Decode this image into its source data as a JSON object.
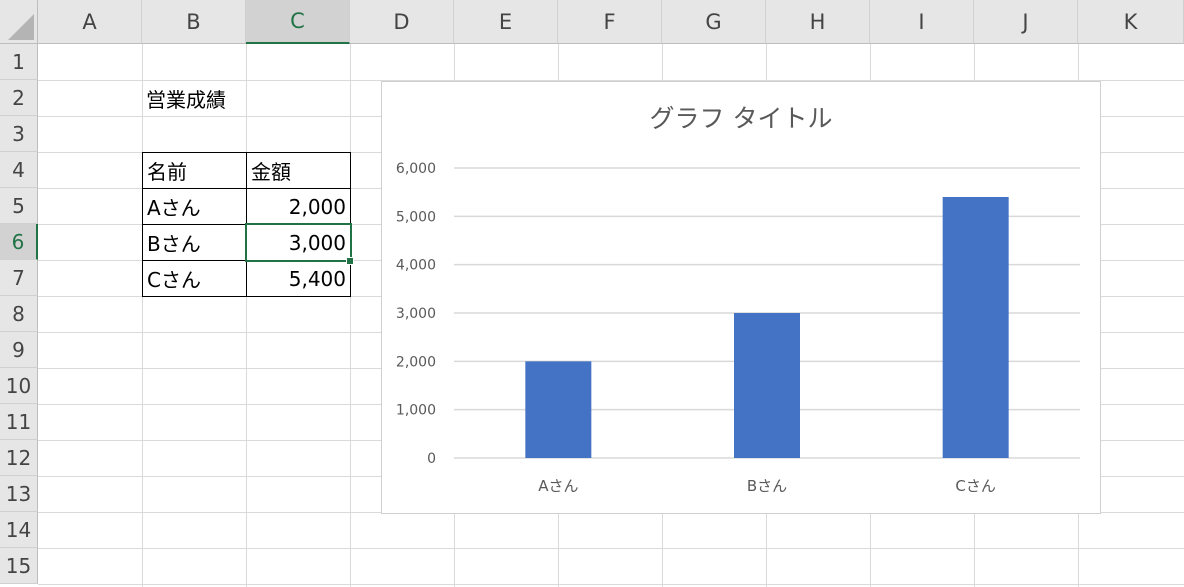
{
  "columns": [
    "A",
    "B",
    "C",
    "D",
    "E",
    "F",
    "G",
    "H",
    "I",
    "J",
    "K"
  ],
  "rows": [
    "1",
    "2",
    "3",
    "4",
    "5",
    "6",
    "7",
    "8",
    "9",
    "10",
    "11",
    "12",
    "13",
    "14",
    "15"
  ],
  "selection": {
    "column": "C",
    "row": "6"
  },
  "cells": {
    "title": "営業成績",
    "header_name": "名前",
    "header_amount": "金額",
    "table": [
      {
        "name": "Aさん",
        "amount": "2,000"
      },
      {
        "name": "Bさん",
        "amount": "3,000"
      },
      {
        "name": "Cさん",
        "amount": "5,400"
      }
    ]
  },
  "colors": {
    "bar": "#4472c4",
    "accent": "#217346",
    "gridline": "#d9d9d9"
  },
  "chart_data": {
    "type": "bar",
    "title": "グラフ タイトル",
    "categories": [
      "Aさん",
      "Bさん",
      "Cさん"
    ],
    "values": [
      2000,
      3000,
      5400
    ],
    "ylim": [
      0,
      6000
    ],
    "yticks": [
      "0",
      "1,000",
      "2,000",
      "3,000",
      "4,000",
      "5,000",
      "6,000"
    ],
    "grid": true,
    "legend": "none"
  }
}
